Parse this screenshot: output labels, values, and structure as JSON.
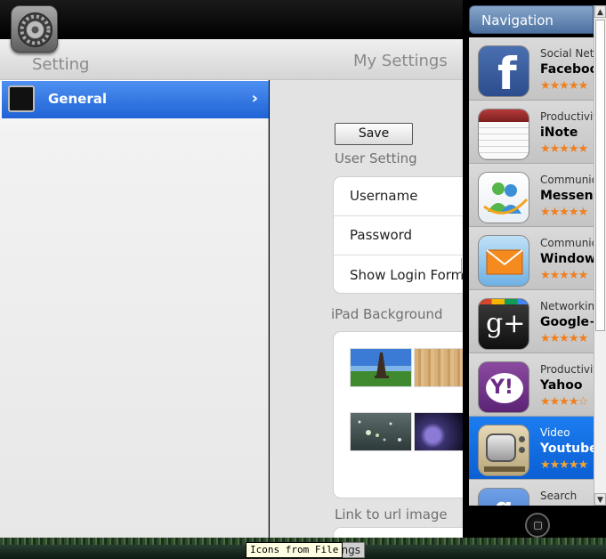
{
  "left": {
    "title": "Setting",
    "general_label": "General",
    "chevron": "›"
  },
  "content": {
    "title": "My Settings",
    "save_label": "Save",
    "user_setting_label": "User Setting",
    "rows": [
      "Username",
      "Password",
      "Show Login Form"
    ],
    "background_label": "iPad Background",
    "link_label": "Link to url image"
  },
  "nav": {
    "title": "Navigation",
    "items": [
      {
        "category": "Social Netw",
        "name": "Facebook",
        "stars": "★★★★★",
        "icon": "facebook-icon"
      },
      {
        "category": "Productivity",
        "name": "iNote",
        "stars": "★★★★★",
        "icon": "notes-icon"
      },
      {
        "category": "Communic",
        "name": "Messenger",
        "stars": "★★★★★",
        "icon": "messenger-icon"
      },
      {
        "category": "Communic",
        "name": "Windows",
        "stars": "★★★★★",
        "icon": "mail-icon"
      },
      {
        "category": "Networkin",
        "name": "Google+",
        "stars": "★★★★★",
        "icon": "google-plus-icon"
      },
      {
        "category": "Productivit",
        "name": "Yahoo",
        "stars": "★★★★☆",
        "icon": "yahoo-icon"
      },
      {
        "category": "Video",
        "name": "Youtube",
        "stars": "★★★★★",
        "icon": "youtube-tv-icon"
      },
      {
        "category": "Search",
        "name": "",
        "stars": "",
        "icon": "google-search-icon"
      }
    ]
  },
  "taskbar": {
    "tooltip": "Icons from File",
    "behind_label": "ngs"
  }
}
